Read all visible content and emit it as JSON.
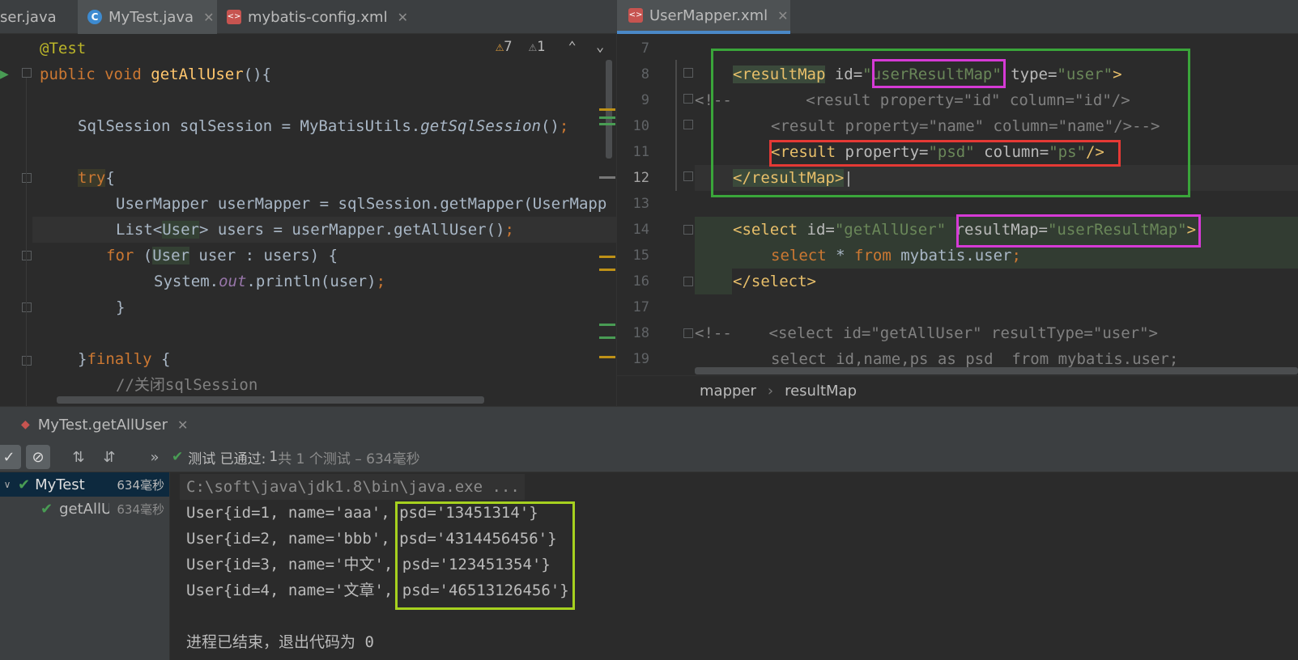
{
  "left_tabs": [
    {
      "label": "ser.java",
      "active": false
    },
    {
      "label": "MyTest.java",
      "active": true
    },
    {
      "label": "mybatis-config.xml",
      "active": false
    }
  ],
  "right_tabs": [
    {
      "label": "UserMapper.xml",
      "active": true
    }
  ],
  "inspections": {
    "warnings": "7",
    "weak_warnings": "1"
  },
  "left_code": [
    "@Test",
    "public void getAllUser(){",
    "",
    "SqlSession sqlSession = MyBatisUtils.getSqlSession();",
    "",
    "try{",
    "UserMapper userMapper = sqlSession.getMapper(UserMapp",
    "List<User> users = userMapper.getAllUser();",
    "for (User user : users) {",
    "System.out.println(user);",
    "}",
    "",
    "}finally {",
    "//关闭sqlSession"
  ],
  "right_line_numbers": [
    "7",
    "8",
    "9",
    "10",
    "11",
    "12",
    "13",
    "14",
    "15",
    "16",
    "17",
    "18",
    "19"
  ],
  "right_code": {
    "l8_tag": "<resultMap",
    "l8_id_attr": "id=",
    "l8_id_val": "\"userResultMap\"",
    "l8_type_attr": "type=",
    "l8_type_val": "\"user\"",
    "l8_end": ">",
    "l9": "<!--        <result property=\"id\" column=\"id\"/>",
    "l10": "<result property=\"name\" column=\"name\"/>-->",
    "l11_tag": "<result",
    "l11_prop_attr": "property=",
    "l11_prop_val": "\"psd\"",
    "l11_col_attr": "column=",
    "l11_col_val": "\"ps\"",
    "l11_end": "/>",
    "l12": "</resultMap>",
    "l14_tag": "<select",
    "l14_id_attr": "id=",
    "l14_id_val": "\"getAllUser\"",
    "l14_rm_attr": "resultMap=",
    "l14_rm_val": "\"userResultMap\"",
    "l14_end": ">",
    "l15_kw1": "select",
    "l15_star": "*",
    "l15_kw2": "from",
    "l15_rest": "mybatis.user",
    "l15_semi": ";",
    "l16": "</select>",
    "l18": "<!--    <select id=\"getAllUser\" resultType=\"user\">",
    "l19": "select id,name,ps as psd  from mybatis.user;"
  },
  "breadcrumb": [
    "mapper",
    "resultMap"
  ],
  "run_tab": "MyTest.getAllUser",
  "run_status": {
    "prefix": "测试 已通过:",
    "passed": "1",
    "suffix": "共 1 个测试 – 634毫秒"
  },
  "tree": [
    {
      "label": "MyTest",
      "time": "634毫秒"
    },
    {
      "label": "getAllU",
      "time": "634毫秒"
    }
  ],
  "console": [
    "C:\\soft\\java\\jdk1.8\\bin\\java.exe ...",
    "User{id=1, name='aaa', psd='13451314'}",
    "User{id=2, name='bbb', psd='4314456456'}",
    "User{id=3, name='中文', psd='123451354'}",
    "User{id=4, name='文章', psd='46513126456'}",
    "",
    "进程已结束，退出代码为 0"
  ],
  "colors": {
    "green_box": "#3aa53a",
    "magenta_box": "#d63ad6",
    "red_box": "#e53935",
    "lime_box": "#a6d11f",
    "tab_underline": "#4a88c7"
  }
}
